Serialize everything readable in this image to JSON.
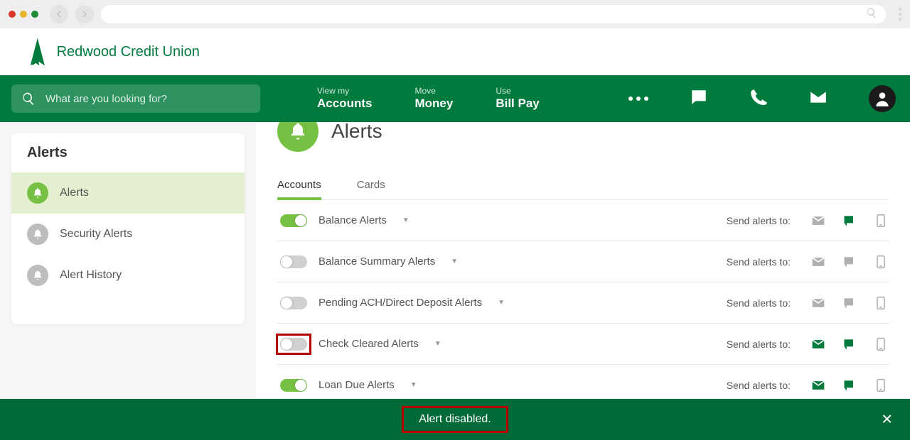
{
  "brand": {
    "name": "Redwood Credit Union"
  },
  "search": {
    "placeholder": "What are you looking for?"
  },
  "nav": {
    "accounts": {
      "small": "View my",
      "big": "Accounts"
    },
    "money": {
      "small": "Move",
      "big": "Money"
    },
    "billpay": {
      "small": "Use",
      "big": "Bill Pay"
    }
  },
  "sidebar": {
    "title": "Alerts",
    "items": [
      {
        "label": "Alerts",
        "active": true
      },
      {
        "label": "Security Alerts",
        "active": false
      },
      {
        "label": "Alert History",
        "active": false
      }
    ]
  },
  "page": {
    "title": "Alerts"
  },
  "tabs": [
    {
      "label": "Accounts",
      "active": true
    },
    {
      "label": "Cards",
      "active": false
    }
  ],
  "send_label": "Send alerts to:",
  "alerts": [
    {
      "name": "Balance Alerts",
      "on": true,
      "email": "grey",
      "push": "green",
      "sms": "grey",
      "highlight": false
    },
    {
      "name": "Balance Summary Alerts",
      "on": false,
      "email": "grey",
      "push": "grey",
      "sms": "grey",
      "highlight": false
    },
    {
      "name": "Pending ACH/Direct Deposit Alerts",
      "on": false,
      "email": "grey",
      "push": "grey",
      "sms": "grey",
      "highlight": false
    },
    {
      "name": "Check Cleared Alerts",
      "on": false,
      "email": "green",
      "push": "green",
      "sms": "grey",
      "highlight": true
    },
    {
      "name": "Loan Due Alerts",
      "on": true,
      "email": "green",
      "push": "green",
      "sms": "grey",
      "highlight": false
    }
  ],
  "toast": {
    "message": "Alert disabled."
  },
  "colors": {
    "green": "#007a3d",
    "grey": "#b0b0b0"
  }
}
